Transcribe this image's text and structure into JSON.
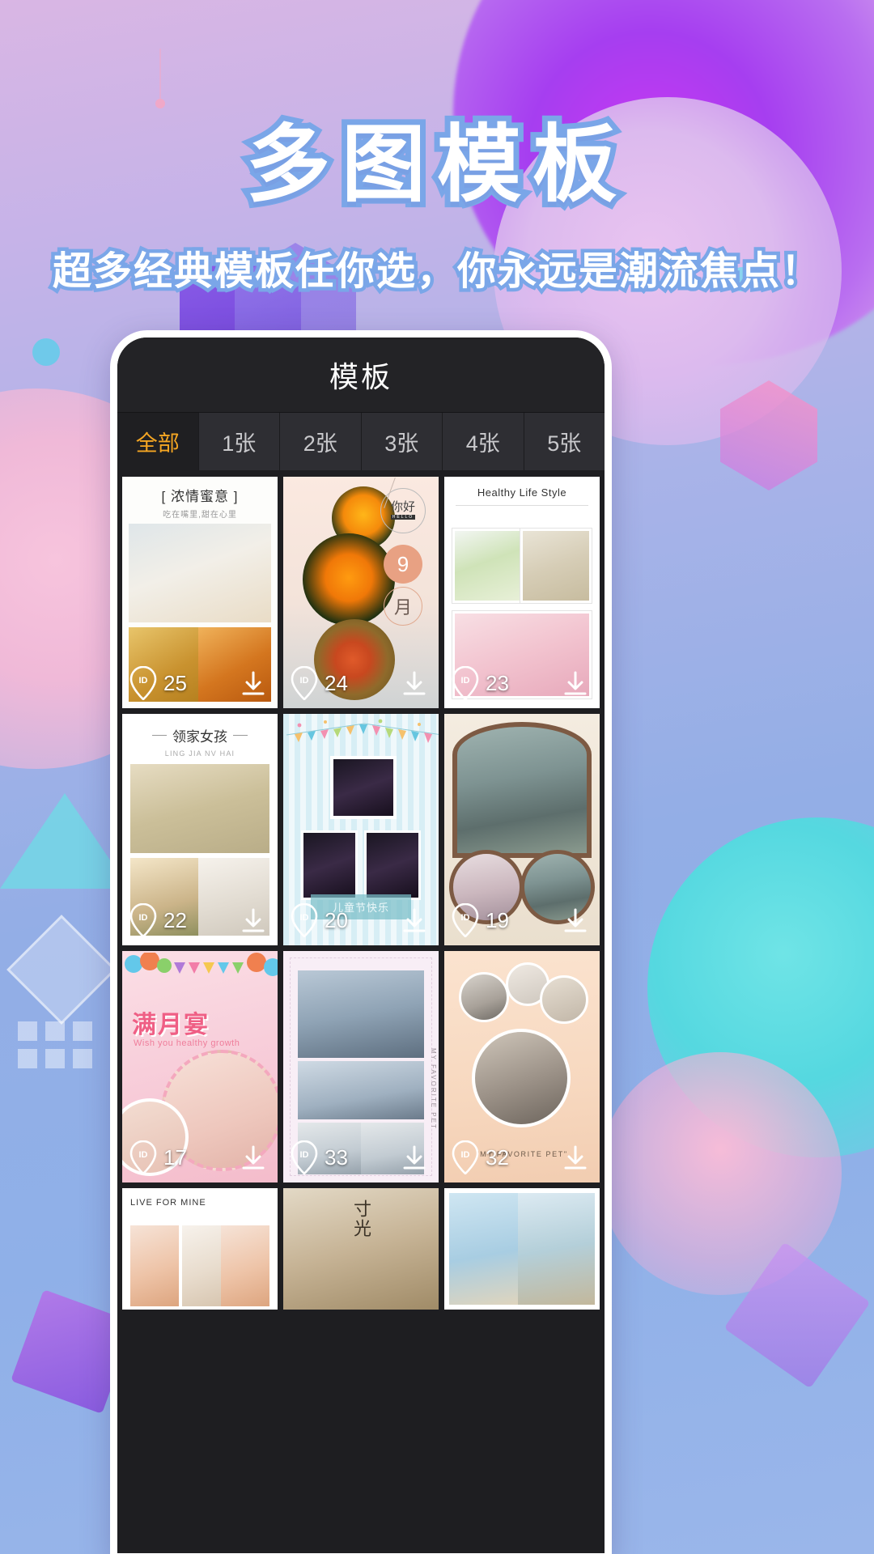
{
  "promo": {
    "title": "多图模板",
    "subtitle": "超多经典模板任你选，你永远是潮流焦点！"
  },
  "phone": {
    "header_title": "模板",
    "tabs": [
      {
        "label": "全部",
        "active": true
      },
      {
        "label": "1张",
        "active": false
      },
      {
        "label": "2张",
        "active": false
      },
      {
        "label": "3张",
        "active": false
      },
      {
        "label": "4张",
        "active": false
      },
      {
        "label": "5张",
        "active": false
      }
    ],
    "id_badge_label": "ID",
    "download_icon": "download-icon",
    "templates": [
      {
        "id": "25",
        "title": "[ 浓情蜜意 ]",
        "subtitle": "吃在嘴里,甜在心里",
        "theme": "honey"
      },
      {
        "id": "24",
        "title": "你好",
        "subtitle": "HELLO",
        "month_number": "9",
        "month_label": "月",
        "theme": "autumn-flowers"
      },
      {
        "id": "23",
        "title": "Healthy Life Style",
        "subtitle": "",
        "theme": "healthy-life"
      },
      {
        "id": "22",
        "title": "领家女孩",
        "subtitle": "LING JIA NV HAI",
        "theme": "girl-next-door"
      },
      {
        "id": "20",
        "title": "儿童节快乐",
        "subtitle": "",
        "theme": "childrens-day"
      },
      {
        "id": "19",
        "title": "",
        "subtitle": "",
        "theme": "hanfu-portrait"
      },
      {
        "id": "17",
        "title": "满月宴",
        "subtitle": "Wish you healthy growth",
        "theme": "baby-full-moon"
      },
      {
        "id": "33",
        "title": "MY FAVORITE PET",
        "subtitle": "",
        "theme": "cats-collage"
      },
      {
        "id": "32",
        "title": "\"MY FAVORITE PET\"",
        "subtitle": "",
        "theme": "pet-circles"
      },
      {
        "id": "",
        "title": "LIVE FOR MINE",
        "subtitle": "",
        "theme": "dessert-grid"
      },
      {
        "id": "",
        "title": "寸光",
        "subtitle": "",
        "theme": "vintage-time"
      },
      {
        "id": "",
        "title": "",
        "subtitle": "",
        "theme": "kids-outdoor"
      }
    ]
  },
  "colors": {
    "accent": "#f5a623",
    "phone_bg": "#1e1e21",
    "header_bg": "#232326",
    "tab_bg": "#2e2e33",
    "outline_blue": "#7aa6e8"
  }
}
